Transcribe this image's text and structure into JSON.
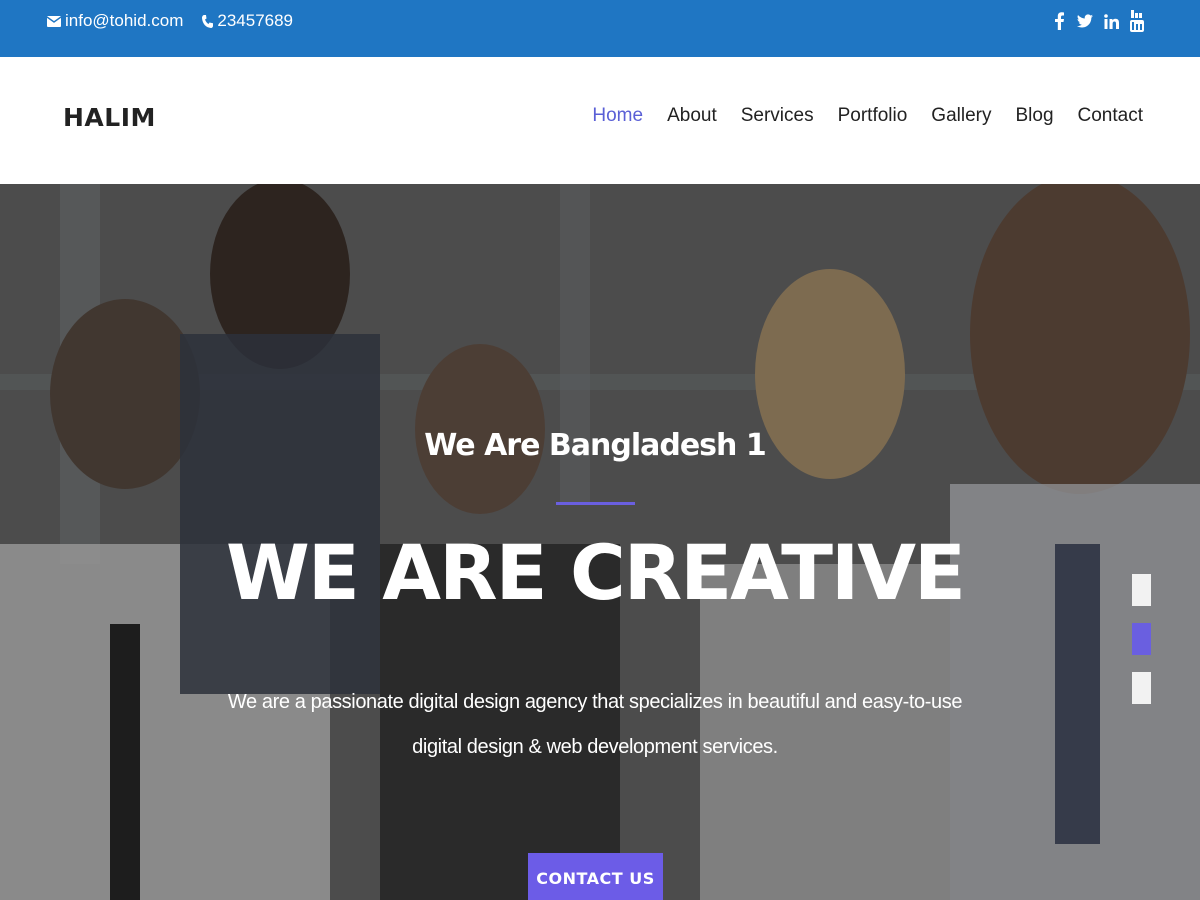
{
  "topbar": {
    "email": "info@tohid.com",
    "phone": "23457689",
    "email_icon": "envelope-icon",
    "phone_icon": "phone-icon",
    "social": [
      {
        "name": "facebook-icon"
      },
      {
        "name": "twitter-icon"
      },
      {
        "name": "linkedin-icon"
      },
      {
        "name": "youtube-icon"
      }
    ]
  },
  "header": {
    "logo": "HALIM",
    "nav": [
      {
        "label": "Home",
        "active": true
      },
      {
        "label": "About"
      },
      {
        "label": "Services"
      },
      {
        "label": "Portfolio"
      },
      {
        "label": "Gallery"
      },
      {
        "label": "Blog"
      },
      {
        "label": "Contact"
      }
    ]
  },
  "hero": {
    "subtitle": "We Are Bangladesh 1",
    "title": "WE ARE CREATIVE",
    "description": "We are a passionate digital design agency that specializes in beautiful and easy-to-use digital design & web development services.",
    "cta_label": "CONTACT US",
    "slides": 3,
    "active_slide": 2
  },
  "colors": {
    "topbar": "#1f76c3",
    "accent": "#6c5ce7",
    "nav_active": "#5a5fd6"
  }
}
